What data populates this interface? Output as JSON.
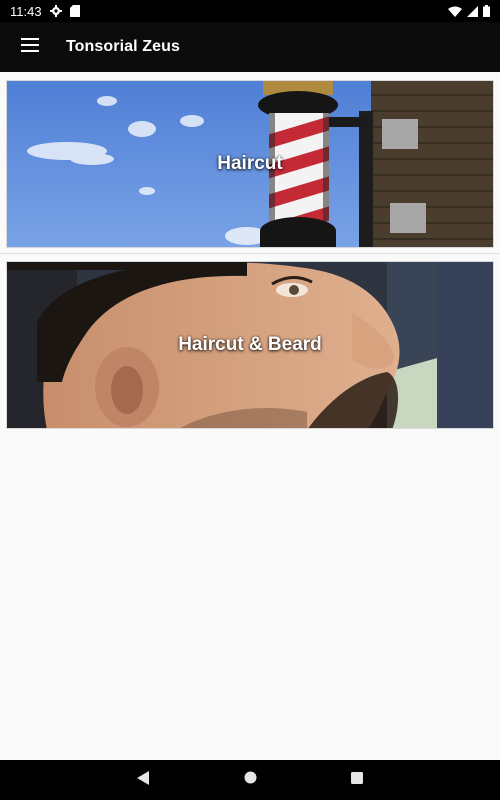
{
  "status_bar": {
    "time": "11:43",
    "icons": [
      "gear-icon",
      "sd-card-icon",
      "wifi-icon",
      "signal-icon",
      "battery-icon"
    ]
  },
  "app_bar": {
    "title": "Tonsorial Zeus",
    "menu_icon": "hamburger-menu-icon"
  },
  "services": [
    {
      "label": "Haircut",
      "image": "barber-pole-photo"
    },
    {
      "label": "Haircut & Beard",
      "image": "man-profile-photo"
    }
  ],
  "nav_bar": {
    "buttons": [
      "back-icon",
      "home-icon",
      "recents-icon"
    ]
  },
  "colors": {
    "status_bar": "#000000",
    "app_bar": "#0b0b0b",
    "background": "#fafafa",
    "nav_bar": "#000000"
  }
}
